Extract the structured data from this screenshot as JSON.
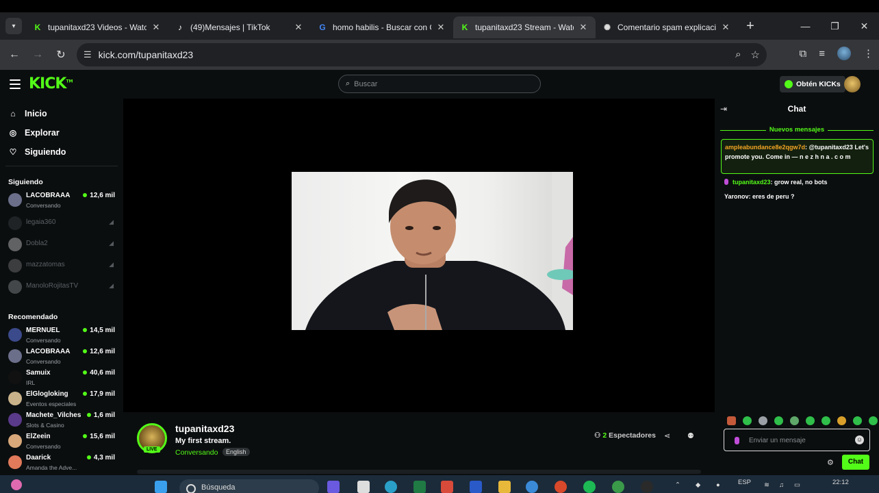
{
  "browser": {
    "tabs": [
      {
        "title": "tupanitaxd23 Videos - Watch",
        "favicon": "kick-icon",
        "active": false
      },
      {
        "title": "(49)Mensajes | TikTok",
        "favicon": "tiktok-icon",
        "active": false
      },
      {
        "title": "homo habilis - Buscar con G",
        "favicon": "google-icon",
        "active": false
      },
      {
        "title": "tupanitaxd23 Stream - Watc",
        "favicon": "kick-icon",
        "active": true
      },
      {
        "title": "Comentario spam explicació",
        "favicon": "openai-icon",
        "active": false
      }
    ],
    "url": "kick.com/tupanitaxd23"
  },
  "header": {
    "logo": "KICK",
    "logo_tm": "TM",
    "search_placeholder": "Buscar",
    "get_kicks": "Obtén KICKs"
  },
  "sidebar": {
    "nav": [
      {
        "label": "Inicio",
        "icon": "home-icon"
      },
      {
        "label": "Explorar",
        "icon": "compass-icon"
      },
      {
        "label": "Siguiendo",
        "icon": "heart-icon"
      }
    ],
    "following_title": "Siguiendo",
    "following": [
      {
        "name": "LACOBRAAA",
        "category": "Conversando",
        "viewers": "12,6 mil",
        "live": true,
        "color": "#6b6f8a"
      },
      {
        "name": "legaia360",
        "live": false,
        "color": "#3a3d40"
      },
      {
        "name": "Dobla2",
        "live": false,
        "color": "#c9c9c9"
      },
      {
        "name": "mazzatomas",
        "live": false,
        "color": "#777"
      },
      {
        "name": "ManoloRojitasTV",
        "live": false,
        "color": "#8a8d90"
      }
    ],
    "recommended_title": "Recomendado",
    "recommended": [
      {
        "name": "MERNUEL",
        "category": "Conversando",
        "viewers": "14,5 mil",
        "color": "#3b4a8a"
      },
      {
        "name": "LACOBRAAA",
        "category": "Conversando",
        "viewers": "12,6 mil",
        "color": "#6b6f8a"
      },
      {
        "name": "Samuix",
        "category": "IRL",
        "viewers": "40,6 mil",
        "color": "#111"
      },
      {
        "name": "ElGlogloking",
        "category": "Eventos especiales",
        "viewers": "17,9 mil",
        "color": "#c9b28a"
      },
      {
        "name": "Machete_Vilches",
        "category": "Slots & Casino",
        "viewers": "1,6 mil",
        "color": "#5a3a8a"
      },
      {
        "name": "ElZeein",
        "category": "Conversando",
        "viewers": "15,6 mil",
        "color": "#d8a87a"
      },
      {
        "name": "Daarick",
        "category": "Amanda the Adve...",
        "viewers": "4,3 mil",
        "color": "#e07a5a"
      }
    ]
  },
  "channel": {
    "name": "tupanitaxd23",
    "live_badge": "LIVE",
    "stream_title": "My first stream.",
    "category": "Conversando",
    "language": "English",
    "viewers_count": "2",
    "viewers_label": "Espectadores"
  },
  "chat": {
    "title": "Chat",
    "new_messages": "Nuevos mensajes",
    "messages": [
      {
        "user": "ampleabundance8e2qgw7d",
        "text": "@tupanitaxd23 Let's promote you. Come in — n e z h n a . c o m",
        "color": "orange",
        "highlighted": true
      },
      {
        "user": "tupanitaxd23",
        "text": "grow real, no bots",
        "color": "green",
        "badge": "mic-icon"
      },
      {
        "user": "Yaronov",
        "text": "eres de peru ?",
        "color": "white"
      }
    ],
    "input_placeholder": "Enviar un mensaje",
    "send_label": "Chat"
  },
  "taskbar": {
    "search_label": "Búsqueda",
    "language": "ESP",
    "time": "22:12"
  }
}
